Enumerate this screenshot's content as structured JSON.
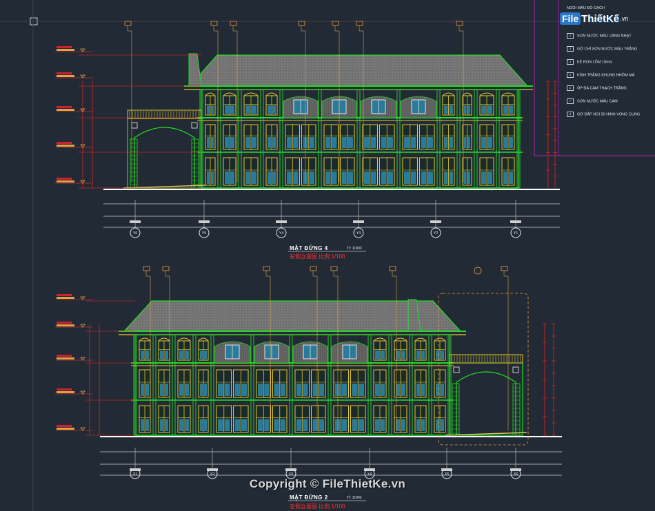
{
  "drawing1": {
    "title": "MẶT ĐỨNG 4",
    "scale": "Tỉ: 1/100",
    "subtitle_cn": "右侧立面图   比例 1/100",
    "axes": [
      "Y6",
      "Y5",
      "Y4",
      "Y3",
      "Y2",
      "Y1"
    ]
  },
  "drawing2": {
    "title": "MẶT ĐỨNG 2",
    "scale": "Tỉ: 1/100",
    "subtitle_cn": "左侧立面图   比例 1/100",
    "axes": [
      "X1",
      "X2",
      "X3",
      "X4",
      "X5",
      "X6"
    ]
  },
  "legend": {
    "header": "NGÓI MÀU ĐỎ GẠCH",
    "items": [
      {
        "num": "2",
        "text": "SƠN NƯỚC MÀU VÀNG NHẠT"
      },
      {
        "num": "3",
        "text": "GỜ CHỈ SƠN NƯỚC MÀU TRẮNG"
      },
      {
        "num": "4",
        "text": "KẺ RON LÕM 10mm"
      },
      {
        "num": "5",
        "text": "KÍNH TRẮNG KHUNG NHÔM MÀ"
      },
      {
        "num": "6",
        "text": "ỐP ĐÁ CẨM THẠCH TRẮNG"
      },
      {
        "num": "7",
        "text": "SƠN NƯỚC MÀU CAM"
      },
      {
        "num": "8",
        "text": "GỜ ĐẮP NỔI 50 HÌNH VÒNG CUNG"
      }
    ]
  },
  "logo": {
    "badge": "File",
    "rest": "ThiếtKế",
    "suffix": ".vn"
  },
  "watermark": "Copyright © FileThietKe.vn",
  "colors": {
    "background": "#222a35",
    "outline": "#22dd22",
    "wall": "#e0c82a",
    "roof": "#9a9a9a",
    "window": "#2a7a9a",
    "dimension": "#ff2222",
    "leader": "#e8a040",
    "legend_border": "#b21fb4"
  }
}
